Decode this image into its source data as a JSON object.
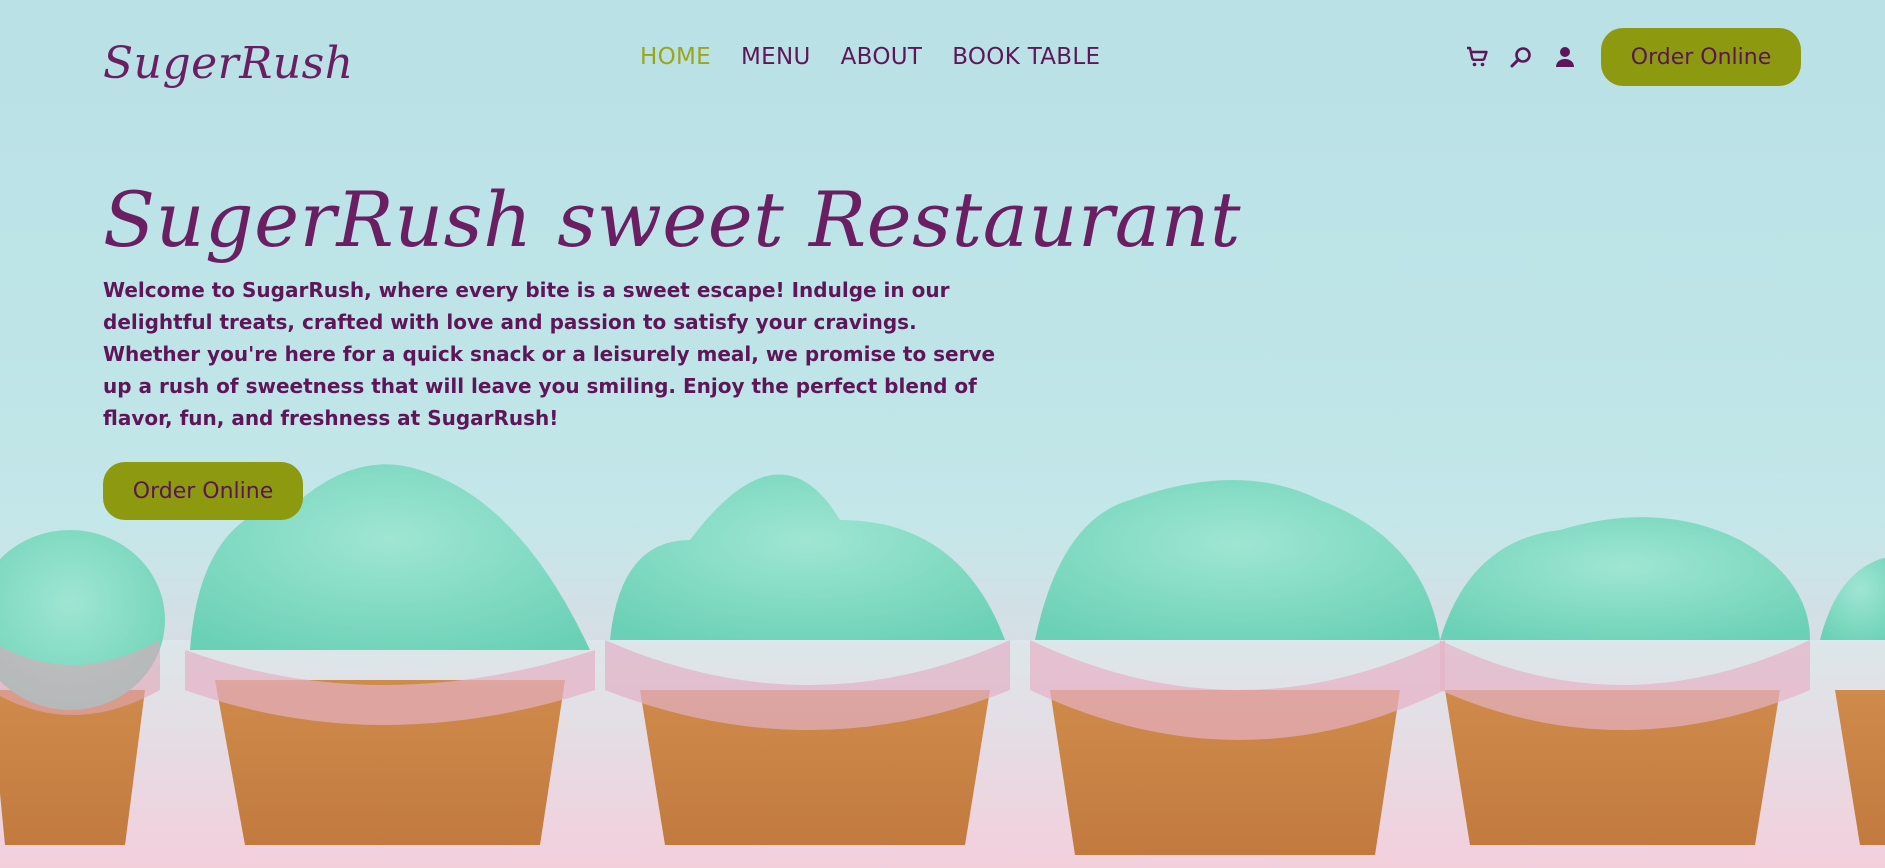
{
  "brand": {
    "logo_text": "SugerRush"
  },
  "nav": {
    "items": [
      {
        "label": "HOME",
        "active": true
      },
      {
        "label": "MENU",
        "active": false
      },
      {
        "label": "ABOUT",
        "active": false
      },
      {
        "label": "BOOK TABLE",
        "active": false
      }
    ]
  },
  "header": {
    "icons": [
      "cart-icon",
      "search-icon",
      "user-icon"
    ],
    "order_label": "Order Online"
  },
  "hero": {
    "title": "SugerRush sweet Restaurant",
    "description": "Welcome to SugarRush, where every bite is a sweet escape! Indulge in our delightful treats, crafted with love and passion to satisfy your cravings. Whether you're here for a quick snack or a leisurely meal, we promise to serve up a rush of sweetness that will leave you smiling. Enjoy the perfect blend of flavor, fun, and freshness at SugarRush!",
    "order_label": "Order Online"
  },
  "colors": {
    "brand_purple": "#6a1f62",
    "nav_active": "#9aa61a",
    "button_green": "#8d9a10",
    "sky": "#bfe3e6"
  }
}
